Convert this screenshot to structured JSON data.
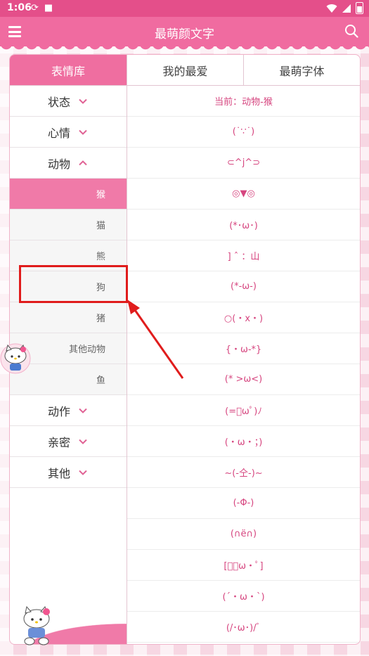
{
  "status_bar": {
    "time": "1:06"
  },
  "app_bar": {
    "title": "最萌颜文字"
  },
  "tabs": [
    {
      "label": "表情库",
      "active": true
    },
    {
      "label": "我的最爱",
      "active": false
    },
    {
      "label": "最萌字体",
      "active": false
    }
  ],
  "sidebar": {
    "categories": [
      {
        "label": "状态",
        "expanded": false
      },
      {
        "label": "心情",
        "expanded": false
      },
      {
        "label": "动物",
        "expanded": true
      },
      {
        "label": "动作",
        "expanded": false
      },
      {
        "label": "亲密",
        "expanded": false
      },
      {
        "label": "其他",
        "expanded": false
      }
    ],
    "animal_subitems": [
      {
        "label": "猴",
        "active": true
      },
      {
        "label": "猫",
        "active": false
      },
      {
        "label": "熊",
        "active": false
      },
      {
        "label": "狗",
        "active": false
      },
      {
        "label": "猪",
        "active": false
      },
      {
        "label": "其他动物",
        "active": false
      },
      {
        "label": "鱼",
        "active": false
      }
    ]
  },
  "content": {
    "current_label": "当前：动物-猴",
    "emoticons": [
      "(˙∵˙)",
      "⊂^j^⊃",
      "◎▼◎",
      "(*･ω･)",
      "] ˆ ：山",
      "(*-ω-)",
      "○(・x・)",
      "{・ω-*}",
      "(* >ω<)",
      "(=ﾟωﾟ)ﾉ",
      "(・ω・；)",
      "~(-仝-)~",
      "(-Φ-)",
      "(∩ë∩)",
      "[ﾟ・ω・ﾟ]",
      "(´・ω・`)",
      "(/･ω･)/ﾞ"
    ]
  },
  "colors": {
    "status_bar": "#e44f8a",
    "app_bar": "#f06ba0",
    "accent": "#ef6ea0",
    "emoticon_text": "#d6457f",
    "annotation": "#e01c1c"
  },
  "icons": {
    "menu": "hamburger-menu-icon",
    "search": "search-icon",
    "chevron_down": "chevron-down-icon",
    "chevron_up": "chevron-up-icon"
  }
}
